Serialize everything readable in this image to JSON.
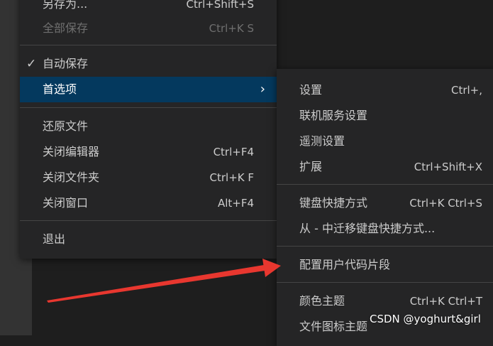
{
  "file_menu": {
    "items": [
      {
        "label": "另存为...",
        "shortcut": "Ctrl+Shift+S"
      },
      {
        "label": "全部保存",
        "shortcut": "Ctrl+K S"
      },
      {
        "label": "自动保存",
        "check": "✓"
      },
      {
        "label": "首选项",
        "chevron": "›"
      },
      {
        "label": "还原文件"
      },
      {
        "label": "关闭编辑器",
        "shortcut": "Ctrl+F4"
      },
      {
        "label": "关闭文件夹",
        "shortcut": "Ctrl+K F"
      },
      {
        "label": "关闭窗口",
        "shortcut": "Alt+F4"
      },
      {
        "label": "退出"
      }
    ]
  },
  "pref_menu": {
    "items": [
      {
        "label": "设置",
        "shortcut": "Ctrl+,"
      },
      {
        "label": "联机服务设置"
      },
      {
        "label": "遥测设置"
      },
      {
        "label": "扩展",
        "shortcut": "Ctrl+Shift+X"
      },
      {
        "label": "键盘快捷方式",
        "shortcut": "Ctrl+K Ctrl+S"
      },
      {
        "label": "从 - 中迁移键盘快捷方式..."
      },
      {
        "label": "配置用户代码片段"
      },
      {
        "label": "颜色主题",
        "shortcut": "Ctrl+K Ctrl+T"
      },
      {
        "label": "文件图标主题"
      }
    ]
  },
  "colors": {
    "menu_bg": "#252526",
    "selected_bg": "#04395e",
    "arrow": "#e8372f"
  },
  "watermark": "CSDN @yoghurt&girl"
}
